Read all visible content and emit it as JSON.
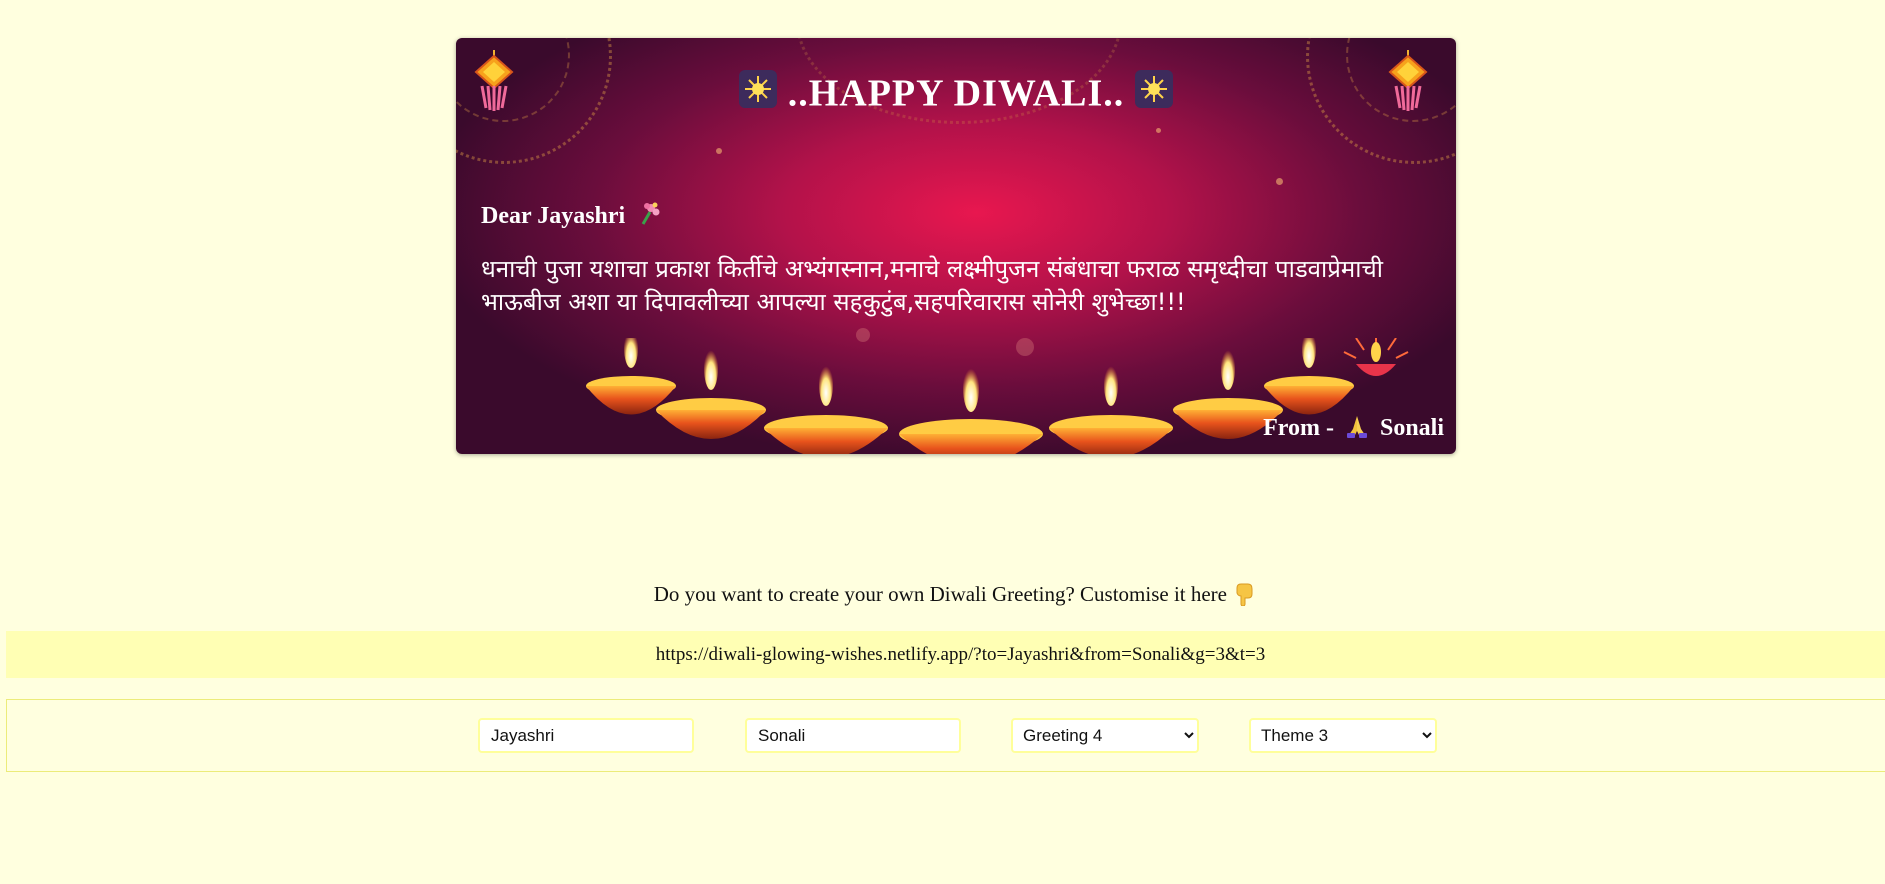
{
  "card": {
    "title": "..HAPPY  DIWALI..",
    "dear": "Dear Jayashri",
    "message": "धनाची पुजा यशाचा प्रकाश किर्तीचे अभ्यंगस्नान,मनाचे लक्ष्मीपुजन संबंधाचा फराळ समृध्दीचा पाडवाप्रेमाची भाऊबीज अशा या दिपावलीच्या आपल्या सहकुटुंब,सहपरिवारास सोनेरी शुभेच्छा!!!",
    "from_label": "From -",
    "from_name": "Sonali",
    "icons": {
      "title_left": "sparkle-icon",
      "title_right": "sparkle-icon",
      "dear": "bouquet-icon",
      "from": "folded-hands-icon",
      "corner_left": "lantern-icon",
      "corner_right": "lantern-icon",
      "diya": "diya-icon"
    },
    "colors": {
      "background_center": "#e8174f",
      "background_edge": "#3a0a2c",
      "text": "#ffffff"
    }
  },
  "prompt": {
    "text": "Do you want to create your own Diwali Greeting? Customise it here",
    "icon": "pointing-down-icon"
  },
  "share_url": "https://diwali-glowing-wishes.netlify.app/?to=Jayashri&from=Sonali&g=3&t=3",
  "form": {
    "to_value": "Jayashri",
    "from_value": "Sonali",
    "greeting_selected": "Greeting 4",
    "theme_selected": "Theme 3"
  },
  "colors": {
    "page_background": "#ffffdf",
    "url_bar_background": "#ffffb4",
    "input_border": "#ffff9a"
  }
}
